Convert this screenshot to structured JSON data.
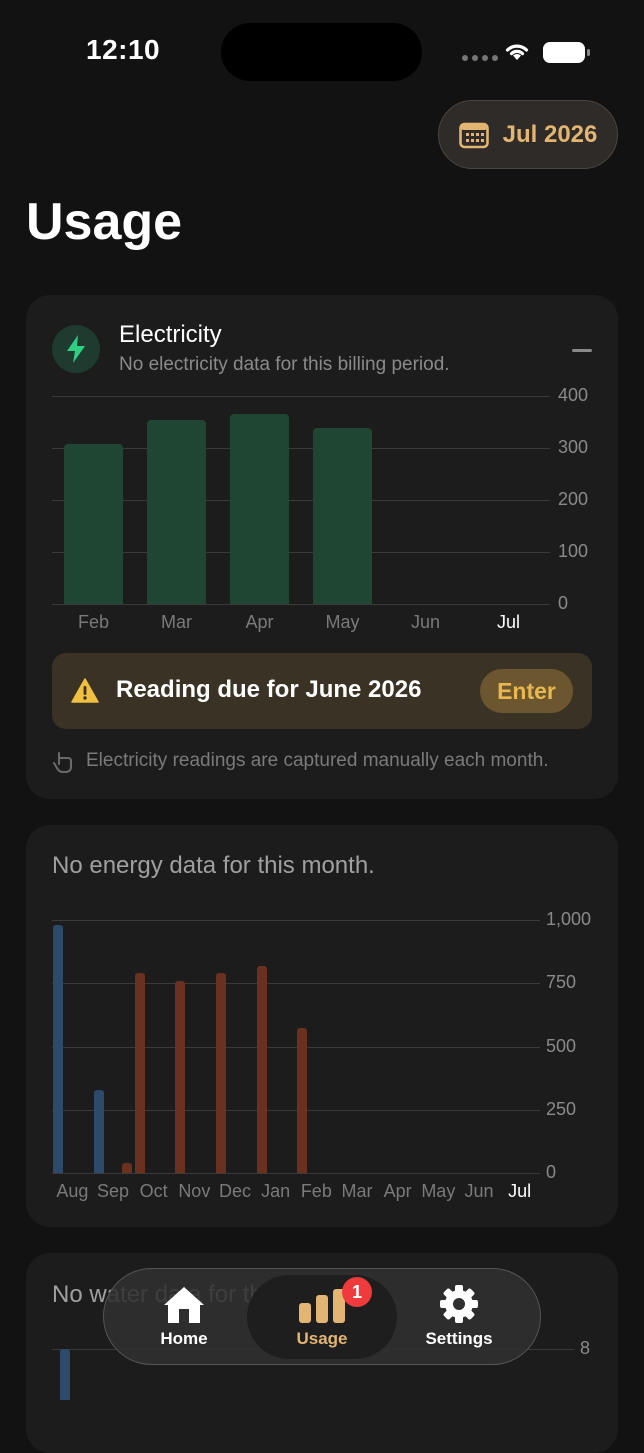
{
  "status_bar": {
    "time": "12:10"
  },
  "header": {
    "month_label": "Jul 2026",
    "title": "Usage"
  },
  "electricity": {
    "title": "Electricity",
    "subtitle": "No electricity data for this billing period.",
    "reading_due": "Reading due for June 2026",
    "enter_label": "Enter",
    "note": "Electricity readings are captured manually each month.",
    "colors": {
      "bar": "#1f4632",
      "icon": "#2fcf82"
    }
  },
  "energy": {
    "message": "No energy data for this month."
  },
  "water": {
    "message": "No water data for this month."
  },
  "tabbar": {
    "items": [
      {
        "label": "Home",
        "icon": "home-icon"
      },
      {
        "label": "Usage",
        "icon": "usage-icon",
        "badge": "1"
      },
      {
        "label": "Settings",
        "icon": "gear-icon"
      }
    ],
    "accent": "#e2b572"
  },
  "chart_data": [
    {
      "type": "bar",
      "categories": [
        "Feb",
        "Mar",
        "Apr",
        "May",
        "Jun",
        "Jul"
      ],
      "values": [
        307,
        354,
        365,
        338,
        null,
        null
      ],
      "ylim": [
        0,
        400
      ],
      "yticks": [
        "400",
        "300",
        "200",
        "100",
        "0"
      ],
      "current": "Jul",
      "grid": true
    },
    {
      "type": "bar",
      "categories": [
        "Aug",
        "Sep",
        "Oct",
        "Nov",
        "Dec",
        "Jan",
        "Feb",
        "Mar",
        "Apr",
        "May",
        "Jun",
        "Jul"
      ],
      "series": [
        {
          "color": "#2e4a6b",
          "values": [
            980,
            330,
            null,
            null,
            null,
            null,
            null,
            null,
            null,
            null,
            null,
            null
          ]
        },
        {
          "color": "#6a3020",
          "values": [
            null,
            40,
            790,
            760,
            790,
            820,
            575,
            null,
            null,
            null,
            null,
            null
          ]
        }
      ],
      "ylim": [
        0,
        1000
      ],
      "yticks": [
        "1,000",
        "750",
        "500",
        "250",
        "0"
      ],
      "current": "Jul",
      "grid": true
    },
    {
      "type": "bar",
      "categories": [],
      "series": [
        {
          "color": "#2e4a6b",
          "values": []
        }
      ],
      "yticks": [
        "8"
      ],
      "grid": true
    }
  ]
}
